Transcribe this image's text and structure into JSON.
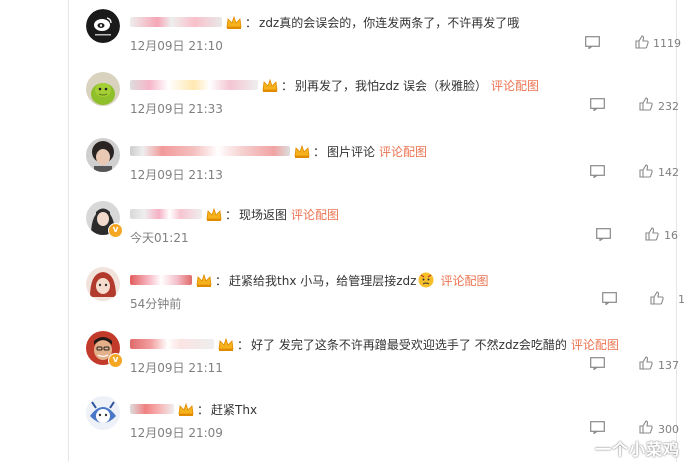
{
  "colors": {
    "link": "#eb7350",
    "meta": "#808080",
    "text": "#333333"
  },
  "comments": [
    {
      "text": "zdz真的会误会的，你连发两条了，不许再发了哦",
      "pic": "",
      "emoji": false,
      "time": "12月09日 21:10",
      "likes": "1119",
      "verified": false
    },
    {
      "text": "别再发了，我怕zdz 误会（秋雅脸）",
      "pic": "评论配图",
      "emoji": false,
      "time": "12月09日 21:33",
      "likes": "232",
      "verified": false
    },
    {
      "text": "图片评论",
      "pic": "评论配图",
      "emoji": false,
      "time": "12月09日 21:13",
      "likes": "142",
      "verified": false
    },
    {
      "text": "现场返图",
      "pic": "评论配图",
      "emoji": false,
      "time": "今天01:21",
      "likes": "16",
      "verified": true
    },
    {
      "text": "赶紧给我thx 小马，给管理层接zdz",
      "pic": "评论配图",
      "emoji": true,
      "time": "54分钟前",
      "likes": "1",
      "verified": false
    },
    {
      "text": "好了 发完了这条不许再蹭最受欢迎选手了 不然zdz会吃醋的",
      "pic": "评论配图",
      "emoji": false,
      "time": "12月09日 21:11",
      "likes": "137",
      "verified": true
    },
    {
      "text": "赶紧Thx",
      "pic": "",
      "emoji": false,
      "time": "12月09日 21:09",
      "likes": "300",
      "verified": false
    }
  ],
  "watermark": "一个小菜鸡"
}
